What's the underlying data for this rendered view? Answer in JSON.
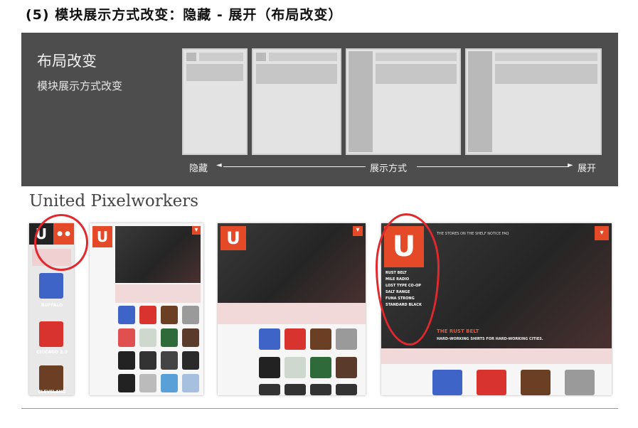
{
  "heading": "(5) 模块展示方式改变：隐藏 - 展开（布局改变）",
  "diagram": {
    "title": "布局改变",
    "subtitle": "模块展示方式改变",
    "left_label": "隐藏",
    "center_label": "展示方式",
    "right_label": "展开"
  },
  "brand": "United Pixelworkers",
  "shots": {
    "s1": {
      "cards": [
        "BUFFALO",
        "CHICAGO 2.0",
        "CLEVELAND"
      ]
    },
    "s4": {
      "nav": "THE STORES  ON THE SHELF  NOTICE  FAQ",
      "menu": [
        "RUST BELT",
        "MILE RADIO",
        "LOST TYPE CO-OP",
        "SALT RANGE",
        "FUNA STRONG",
        "STANDARD BLACK"
      ],
      "caption": "THE RUST BELT",
      "subcaption": "HARD-WORKING SHIRTS FOR HARD-WORKING CITIES."
    }
  },
  "colors": {
    "brand": "#e44a28",
    "circle": "#e0282e",
    "panel": "#4d4d4d"
  }
}
